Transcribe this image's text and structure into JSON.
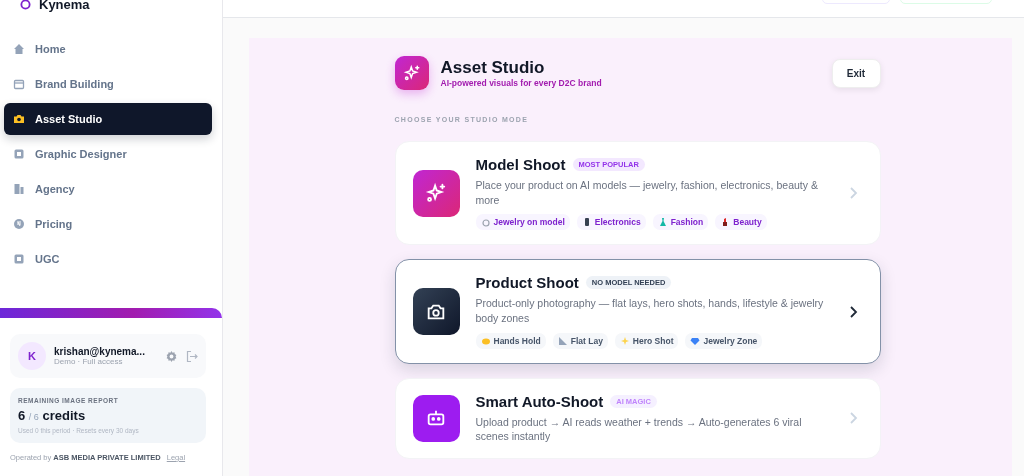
{
  "brand": {
    "name": "Kynema"
  },
  "nav": [
    {
      "label": "Home",
      "selected": false
    },
    {
      "label": "Brand Building",
      "selected": false
    },
    {
      "label": "Asset Studio",
      "selected": true
    },
    {
      "label": "Graphic Designer",
      "selected": false
    },
    {
      "label": "Agency",
      "selected": false
    },
    {
      "label": "Pricing",
      "selected": false
    },
    {
      "label": "UGC",
      "selected": false
    }
  ],
  "user": {
    "initial": "K",
    "email": "krishan@kynema...",
    "plan": "Demo · Full access"
  },
  "credits": {
    "title": "REMAINING IMAGE REPORT",
    "used": "6",
    "total": "/ 6",
    "unit": "credits",
    "note": "Used 0 this period · Resets every 30 days"
  },
  "footer": {
    "text": "Operated by **ASB MEDIA PRIVATE LIMITED**",
    "link": "Legal"
  },
  "studio": {
    "title": "Asset Studio",
    "subtitle": "AI-powered visuals for every D2C brand",
    "exit": "Exit",
    "section": "CHOOSE YOUR STUDIO MODE"
  },
  "modes": [
    {
      "title": "Model Shoot",
      "badge": "MOST POPULAR",
      "description": "Place your product on AI models — jewelry, fashion, electronics, beauty & more",
      "selected": false,
      "tags": [
        "Jewelry on model",
        "Electronics",
        "Fashion",
        "Beauty"
      ]
    },
    {
      "title": "Product Shoot",
      "badge": "NO MODEL NEEDED",
      "description": "Product-only photography — flat lays, hero shots, hands, lifestyle & jewelry body zones",
      "selected": true,
      "tags": [
        "Hands Hold",
        "Flat Lay",
        "Hero Shot",
        "Jewelry Zone"
      ]
    },
    {
      "title": "Smart Auto-Shoot",
      "badge": "AI MAGIC",
      "description": "Upload product → AI reads weather + trends → Auto-generates 6 viral scenes instantly",
      "selected": false
    }
  ]
}
